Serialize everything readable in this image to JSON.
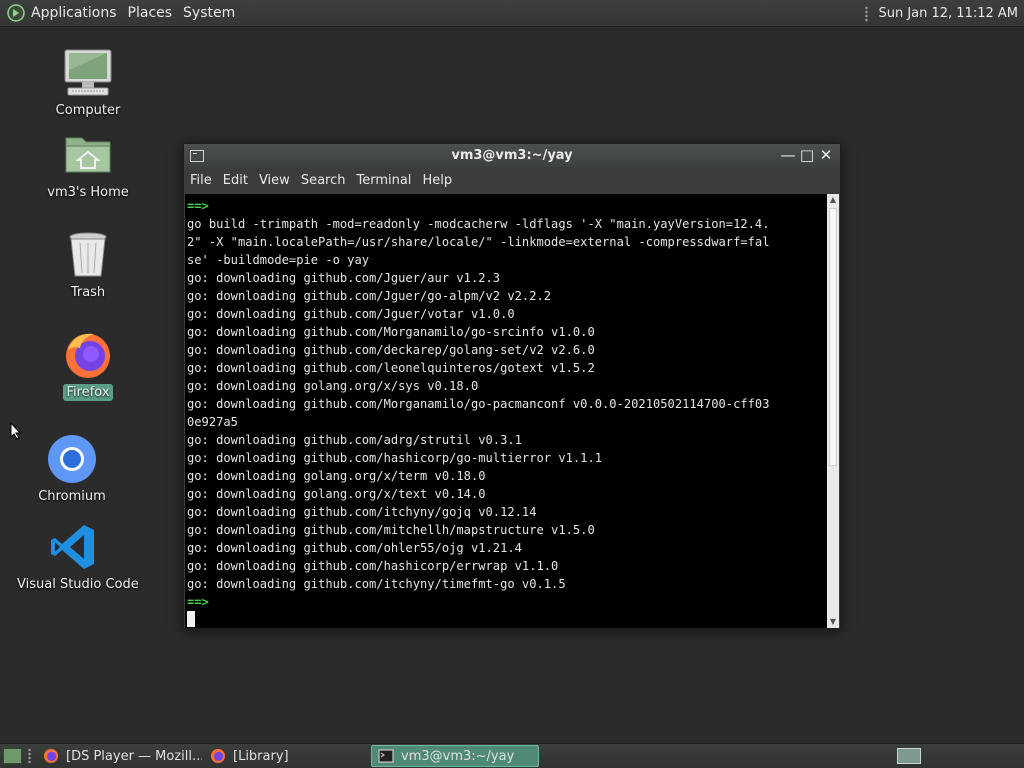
{
  "top_panel": {
    "menus": [
      "Applications",
      "Places",
      "System"
    ],
    "clock": "Sun Jan 12, 11:12 AM"
  },
  "desktop": {
    "icons": [
      {
        "label": "Computer",
        "icon": "computer-icon"
      },
      {
        "label": "vm3's Home",
        "icon": "home-folder-icon"
      },
      {
        "label": "Trash",
        "icon": "trash-icon"
      },
      {
        "label": "Firefox",
        "icon": "firefox-icon",
        "selected": true
      },
      {
        "label": "Chromium",
        "icon": "chromium-icon"
      },
      {
        "label": "Visual Studio Code",
        "icon": "vscode-icon"
      }
    ]
  },
  "terminal": {
    "title": "vm3@vm3:~/yay",
    "menu": [
      "File",
      "Edit",
      "View",
      "Search",
      "Terminal",
      "Help"
    ],
    "lines": [
      {
        "text": "==>",
        "prompt": true
      },
      {
        "text": "go build -trimpath -mod=readonly -modcacherw -ldflags '-X \"main.yayVersion=12.4."
      },
      {
        "text": "2\" -X \"main.localePath=/usr/share/locale/\" -linkmode=external -compressdwarf=fal"
      },
      {
        "text": "se' -buildmode=pie -o yay"
      },
      {
        "text": "go: downloading github.com/Jguer/aur v1.2.3"
      },
      {
        "text": "go: downloading github.com/Jguer/go-alpm/v2 v2.2.2"
      },
      {
        "text": "go: downloading github.com/Jguer/votar v1.0.0"
      },
      {
        "text": "go: downloading github.com/Morganamilo/go-srcinfo v1.0.0"
      },
      {
        "text": "go: downloading github.com/deckarep/golang-set/v2 v2.6.0"
      },
      {
        "text": "go: downloading github.com/leonelquinteros/gotext v1.5.2"
      },
      {
        "text": "go: downloading golang.org/x/sys v0.18.0"
      },
      {
        "text": "go: downloading github.com/Morganamilo/go-pacmanconf v0.0.0-20210502114700-cff03"
      },
      {
        "text": "0e927a5"
      },
      {
        "text": "go: downloading github.com/adrg/strutil v0.3.1"
      },
      {
        "text": "go: downloading github.com/hashicorp/go-multierror v1.1.1"
      },
      {
        "text": "go: downloading golang.org/x/term v0.18.0"
      },
      {
        "text": "go: downloading golang.org/x/text v0.14.0"
      },
      {
        "text": "go: downloading github.com/itchyny/gojq v0.12.14"
      },
      {
        "text": "go: downloading github.com/mitchellh/mapstructure v1.5.0"
      },
      {
        "text": "go: downloading github.com/ohler55/ojg v1.21.4"
      },
      {
        "text": "go: downloading github.com/hashicorp/errwrap v1.1.0"
      },
      {
        "text": "go: downloading github.com/itchyny/timefmt-go v0.1.5"
      },
      {
        "text": "==>",
        "prompt": true
      }
    ]
  },
  "taskbar": {
    "tasks": [
      {
        "label": "[DS Player — Mozill...",
        "icon": "firefox-icon"
      },
      {
        "label": "[Library]",
        "icon": "firefox-icon"
      },
      {
        "label": "vm3@vm3:~/yay",
        "icon": "terminal-icon",
        "active": true
      }
    ]
  },
  "colors": {
    "desktop_bg": "#2b2b2b",
    "accent": "#5a9e86",
    "prompt": "#3fd24a",
    "terminal_bg": "#000000"
  }
}
